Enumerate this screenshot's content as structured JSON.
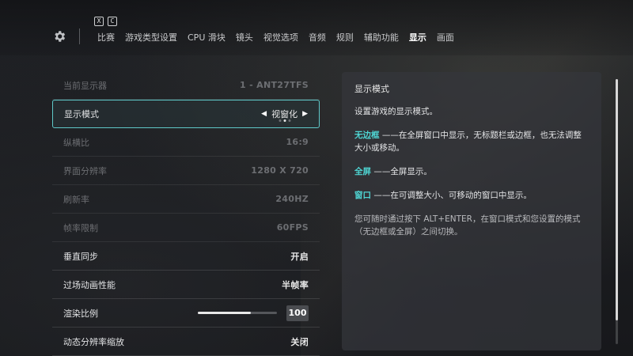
{
  "header": {
    "keys": [
      "X",
      "C"
    ],
    "tabs": [
      "比赛",
      "游戏类型设置",
      "CPU 滑块",
      "镜头",
      "视觉选项",
      "音频",
      "规则",
      "辅助功能",
      "显示",
      "画面"
    ],
    "active_tab": "显示"
  },
  "settings": {
    "monitor": {
      "label": "当前显示器",
      "value": "1 - ANT27TFS"
    },
    "display_mode": {
      "label": "显示模式",
      "value": "视窗化",
      "option_count": 3,
      "option_index": 1
    },
    "aspect": {
      "label": "纵横比",
      "value": "16:9"
    },
    "resolution": {
      "label": "界面分辨率",
      "value": "1280 X 720"
    },
    "refresh": {
      "label": "刷新率",
      "value": "240HZ"
    },
    "fps_limit": {
      "label": "帧率限制",
      "value": "60FPS"
    },
    "vsync": {
      "label": "垂直同步",
      "value": "开启"
    },
    "cutscene": {
      "label": "过场动画性能",
      "value": "半帧率"
    },
    "render_scale": {
      "label": "渲染比例",
      "value": "100",
      "fill": 0.67
    },
    "dynamic_res": {
      "label": "动态分辨率缩放",
      "value": "关闭"
    }
  },
  "help": {
    "title": "显示模式",
    "intro": "设置游戏的显示模式。",
    "borderless_term": "无边框",
    "borderless_desc": " ——在全屏窗口中显示，无标题栏或边框，也无法调整大小或移动。",
    "fullscreen_term": "全屏",
    "fullscreen_desc": " ——全屏显示。",
    "window_term": "窗口",
    "window_desc": " ——在可调整大小、可移动的窗口中显示。",
    "note": "您可随时通过按下 ALT+ENTER，在窗口模式和您设置的模式（无边框或全屏）之间切换。"
  },
  "colors": {
    "accent": "#4fd6d4",
    "selected_border": "#5fc9c9"
  },
  "icons": [
    "gear-icon",
    "arrow-left-icon",
    "arrow-right-icon"
  ]
}
